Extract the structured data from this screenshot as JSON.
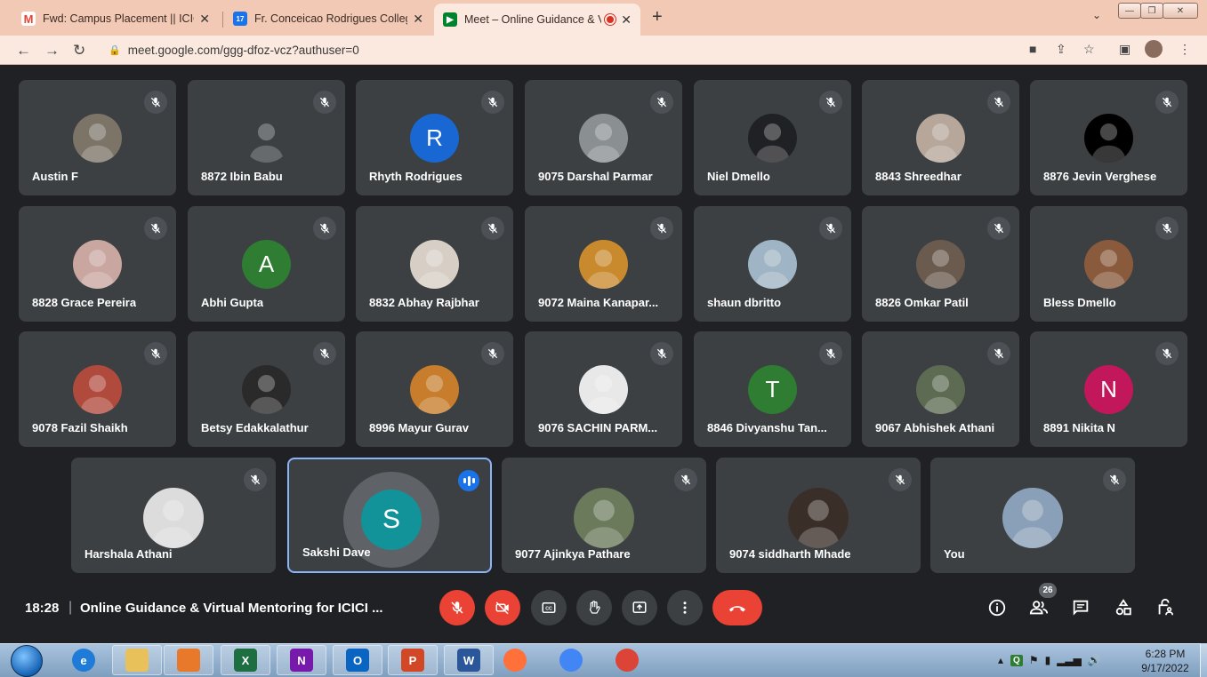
{
  "browser": {
    "tabs": [
      {
        "label": "Fwd: Campus Placement || ICICI L",
        "favicon": "gmail-icon",
        "color": "#ea4335"
      },
      {
        "label": "Fr. Conceicao Rodrigues College",
        "favicon": "calendar-icon",
        "color": "#1a73e8",
        "badge": "17"
      },
      {
        "label": "Meet – Online Guidance & V",
        "favicon": "meet-icon",
        "color": "#00832d"
      }
    ],
    "url": "meet.google.com/ggg-dfoz-vcz?authuser=0"
  },
  "tiles_rows": [
    [
      {
        "name": "Austin F",
        "avatar": {
          "kind": "photo",
          "color": "#7b7467"
        }
      },
      {
        "name": "8872 Ibin Babu",
        "avatar": {
          "kind": "photo",
          "color": "#3c4043"
        }
      },
      {
        "name": "Rhyth Rodrigues",
        "avatar": {
          "kind": "letter",
          "letter": "R",
          "color": "#1967d2"
        }
      },
      {
        "name": "9075 Darshal Parmar",
        "avatar": {
          "kind": "photo",
          "color": "#8a8f92"
        }
      },
      {
        "name": "Niel Dmello",
        "avatar": {
          "kind": "photo",
          "color": "#202124"
        }
      },
      {
        "name": "8843 Shreedhar",
        "avatar": {
          "kind": "photo",
          "color": "#b6a79a"
        }
      },
      {
        "name": "8876 Jevin Verghese",
        "avatar": {
          "kind": "photo",
          "color": "#000000"
        }
      }
    ],
    [
      {
        "name": "8828 Grace Pereira",
        "avatar": {
          "kind": "photo",
          "color": "#c9a6a0"
        }
      },
      {
        "name": "Abhi Gupta",
        "avatar": {
          "kind": "letter",
          "letter": "A",
          "color": "#2e7d32"
        }
      },
      {
        "name": "8832 Abhay Rajbhar",
        "avatar": {
          "kind": "photo",
          "color": "#d7cfc6"
        }
      },
      {
        "name": "9072 Maina Kanapar...",
        "avatar": {
          "kind": "photo",
          "color": "#c98a2e"
        }
      },
      {
        "name": "shaun dbritto",
        "avatar": {
          "kind": "photo",
          "color": "#9fb4c4"
        }
      },
      {
        "name": "8826 Omkar Patil",
        "avatar": {
          "kind": "photo",
          "color": "#6b5a4e"
        }
      },
      {
        "name": "Bless Dmello",
        "avatar": {
          "kind": "photo",
          "color": "#8a5a3c"
        }
      }
    ],
    [
      {
        "name": "9078 Fazil Shaikh",
        "avatar": {
          "kind": "photo",
          "color": "#b04a3c"
        }
      },
      {
        "name": "Betsy Edakkalathur",
        "avatar": {
          "kind": "photo",
          "color": "#2a2a2a"
        }
      },
      {
        "name": "8996 Mayur Gurav",
        "avatar": {
          "kind": "photo",
          "color": "#c77d2b"
        }
      },
      {
        "name": "9076 SACHIN PARM...",
        "avatar": {
          "kind": "photo",
          "color": "#e8e8e8"
        }
      },
      {
        "name": "8846 Divyanshu Tan...",
        "avatar": {
          "kind": "letter",
          "letter": "T",
          "color": "#2e7d32"
        }
      },
      {
        "name": "9067 Abhishek Athani",
        "avatar": {
          "kind": "photo",
          "color": "#5d6b52"
        }
      },
      {
        "name": "8891 Nikita N",
        "avatar": {
          "kind": "letter",
          "letter": "N",
          "color": "#c2185b"
        }
      }
    ],
    [
      {
        "name": "Harshala Athani",
        "avatar": {
          "kind": "photo",
          "color": "#dcdcdc"
        }
      },
      {
        "name": "Sakshi Dave",
        "avatar": {
          "kind": "letter",
          "letter": "S",
          "color": "#12939a"
        },
        "speaking": true
      },
      {
        "name": "9077 Ajinkya Pathare",
        "avatar": {
          "kind": "photo",
          "color": "#6a7a5a"
        }
      },
      {
        "name": "9074 siddharth Mhade",
        "avatar": {
          "kind": "photo",
          "color": "#3a2e28"
        }
      },
      {
        "name": "You",
        "avatar": {
          "kind": "photo",
          "color": "#8aa0b8"
        }
      }
    ]
  ],
  "bottom_bar": {
    "time": "18:28",
    "divider": "|",
    "meeting_title": "Online Guidance & Virtual Mentoring for ICICI ...",
    "participant_count": "26"
  },
  "taskbar": {
    "time": "6:28 PM",
    "date": "9/17/2022",
    "apps": [
      {
        "name": "internet-explorer-icon",
        "label": "e",
        "color": "#1e7bd8"
      },
      {
        "name": "file-explorer-icon",
        "label": "",
        "color": "#e8c15a"
      },
      {
        "name": "media-player-icon",
        "label": "",
        "color": "#e8792a"
      },
      {
        "name": "excel-icon",
        "label": "X",
        "color": "#1d6f42"
      },
      {
        "name": "onenote-icon",
        "label": "N",
        "color": "#7719aa"
      },
      {
        "name": "outlook-icon",
        "label": "O",
        "color": "#0a64c2"
      },
      {
        "name": "powerpoint-icon",
        "label": "P",
        "color": "#d24726"
      },
      {
        "name": "word-icon",
        "label": "W",
        "color": "#2b579a"
      },
      {
        "name": "firefox-icon",
        "label": "",
        "color": "#ff7139"
      },
      {
        "name": "chrome-icon",
        "label": "",
        "color": "#4285f4"
      },
      {
        "name": "chrome-profile-icon",
        "label": "",
        "color": "#db4437"
      }
    ]
  }
}
